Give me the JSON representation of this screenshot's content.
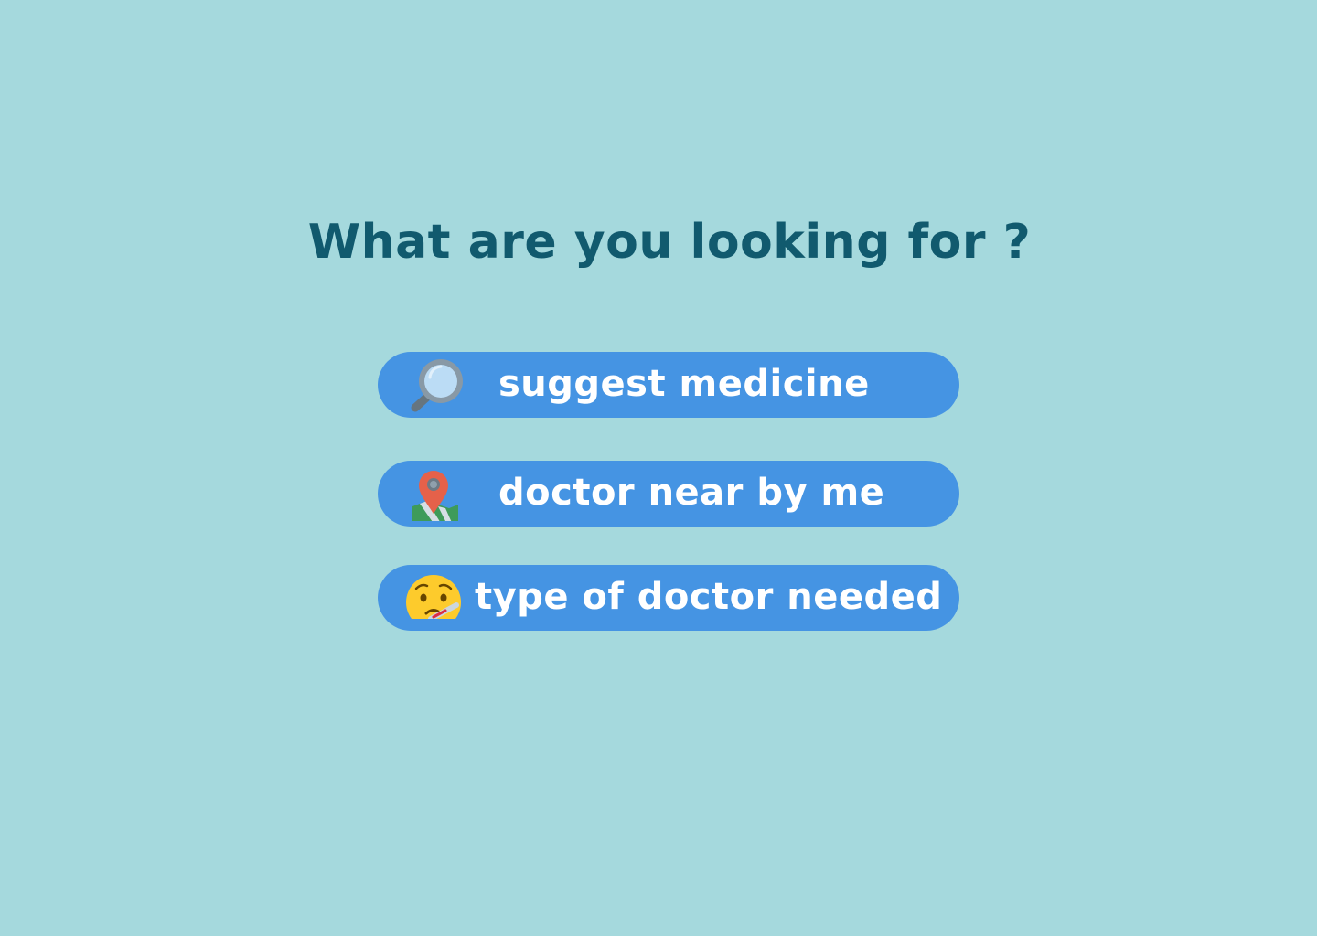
{
  "title": "What are you looking for ?",
  "options": [
    {
      "icon": "magnifying-glass-icon",
      "label": "suggest medicine"
    },
    {
      "icon": "map-pin-icon",
      "label": "doctor near by me"
    },
    {
      "icon": "face-with-thermometer-icon",
      "label": "type of doctor needed"
    }
  ],
  "colors": {
    "background": "#a5d9dd",
    "title": "#115a6e",
    "button": "#4594e3",
    "button_text": "#ffffff"
  }
}
